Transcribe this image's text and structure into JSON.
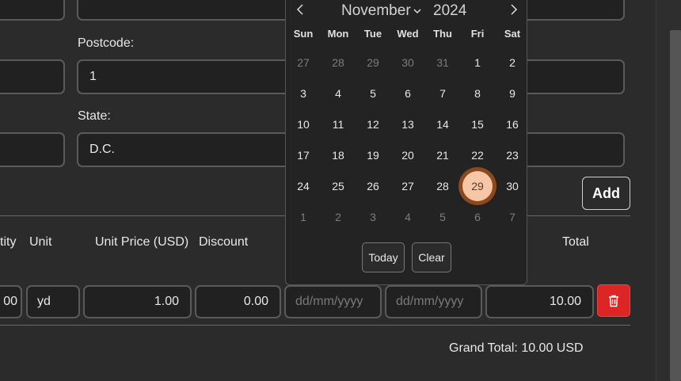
{
  "address": {
    "postcode_label": "Postcode:",
    "postcode_value": "1",
    "state_label": "State:",
    "state_value": "D.C."
  },
  "add_button": "Add",
  "items_table": {
    "headers": {
      "quantity": "tity",
      "unit": "Unit",
      "unit_price": "Unit Price (USD)",
      "discount": "Discount",
      "total": "Total"
    },
    "row": {
      "quantity": "00",
      "unit": "yd",
      "unit_price": "1.00",
      "discount": "0.00",
      "start_date_placeholder": "dd/mm/yyyy",
      "end_date_placeholder": "dd/mm/yyyy",
      "total": "10.00"
    },
    "grand_total": "Grand Total: 10.00 USD"
  },
  "datepicker": {
    "month": "November",
    "year": "2024",
    "weekdays": [
      "Sun",
      "Mon",
      "Tue",
      "Wed",
      "Thu",
      "Fri",
      "Sat"
    ],
    "weeks": [
      [
        "27",
        "28",
        "29",
        "30",
        "31",
        "1",
        "2"
      ],
      [
        "3",
        "4",
        "5",
        "6",
        "7",
        "8",
        "9"
      ],
      [
        "10",
        "11",
        "12",
        "13",
        "14",
        "15",
        "16"
      ],
      [
        "17",
        "18",
        "19",
        "20",
        "21",
        "22",
        "23"
      ],
      [
        "24",
        "25",
        "26",
        "27",
        "28",
        "29",
        "30"
      ],
      [
        "1",
        "2",
        "3",
        "4",
        "5",
        "6",
        "7"
      ]
    ],
    "selected_day": "29",
    "today_label": "Today",
    "clear_label": "Clear",
    "accent_color": "#f6c6a7"
  },
  "colors": {
    "background": "#2b2b2b",
    "delete_button": "#dc2626"
  }
}
